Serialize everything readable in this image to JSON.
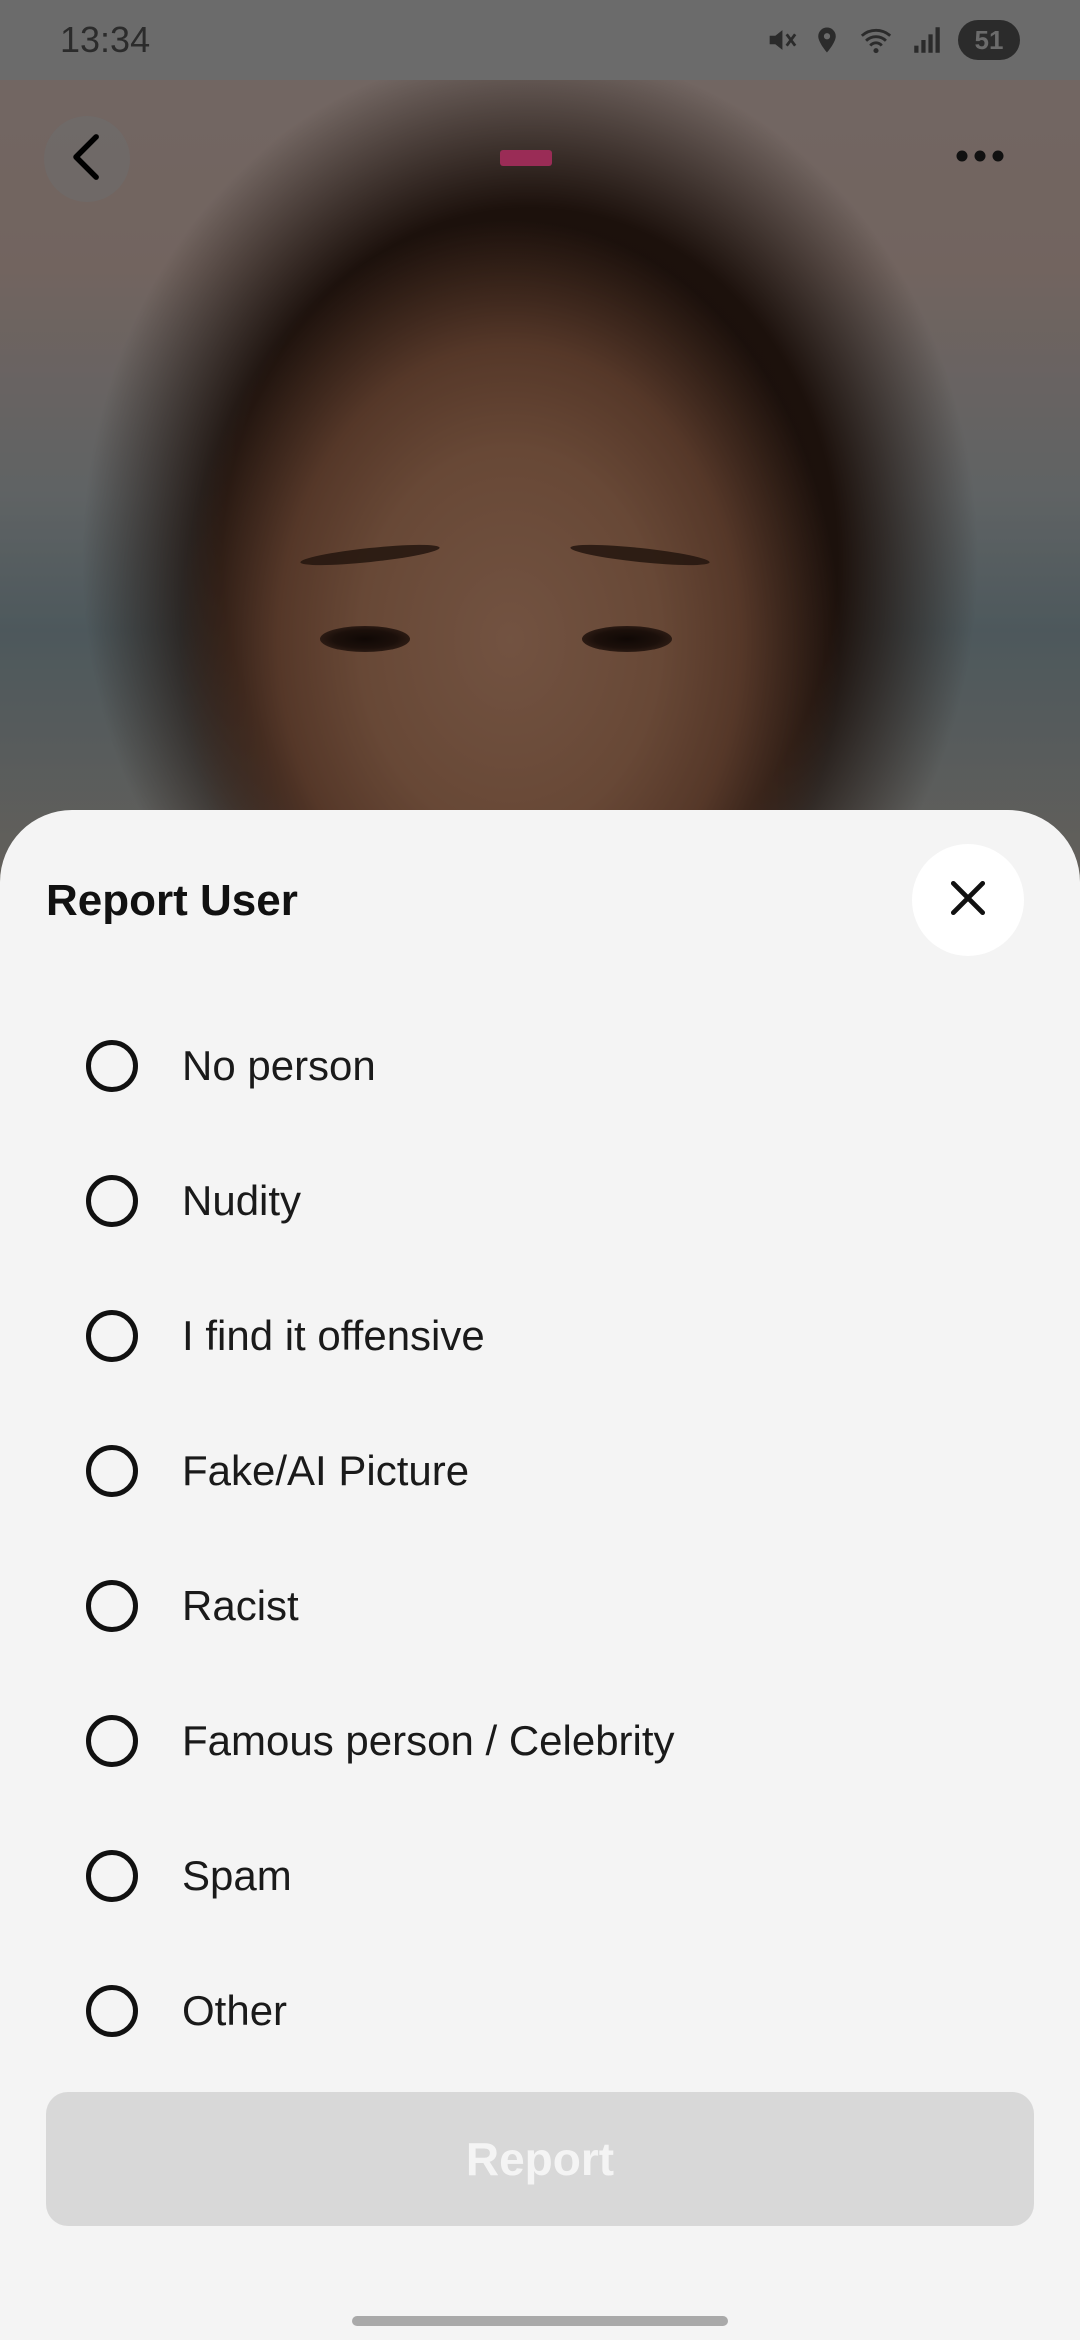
{
  "status_bar": {
    "time": "13:34",
    "battery": "51",
    "icons": [
      "mute-icon",
      "location-icon",
      "wifi-icon",
      "signal-icon",
      "battery-icon"
    ]
  },
  "profile": {
    "back_icon": "chevron-left-icon",
    "more_icon": "more-horizontal-icon",
    "photo_indicator_color": "#9a2c56"
  },
  "report_sheet": {
    "title": "Report User",
    "close_icon": "close-icon",
    "options": [
      {
        "label": "No person",
        "selected": false
      },
      {
        "label": "Nudity",
        "selected": false
      },
      {
        "label": "I find it offensive",
        "selected": false
      },
      {
        "label": "Fake/AI Picture",
        "selected": false
      },
      {
        "label": "Racist",
        "selected": false
      },
      {
        "label": "Famous person / Celebrity",
        "selected": false
      },
      {
        "label": "Spam",
        "selected": false
      },
      {
        "label": "Other",
        "selected": false
      }
    ],
    "submit_label": "Report",
    "submit_enabled": false
  },
  "colors": {
    "sheet_background": "#f4f4f4",
    "disabled_button": "#d8d8d8",
    "accent": "#9a2c56"
  }
}
